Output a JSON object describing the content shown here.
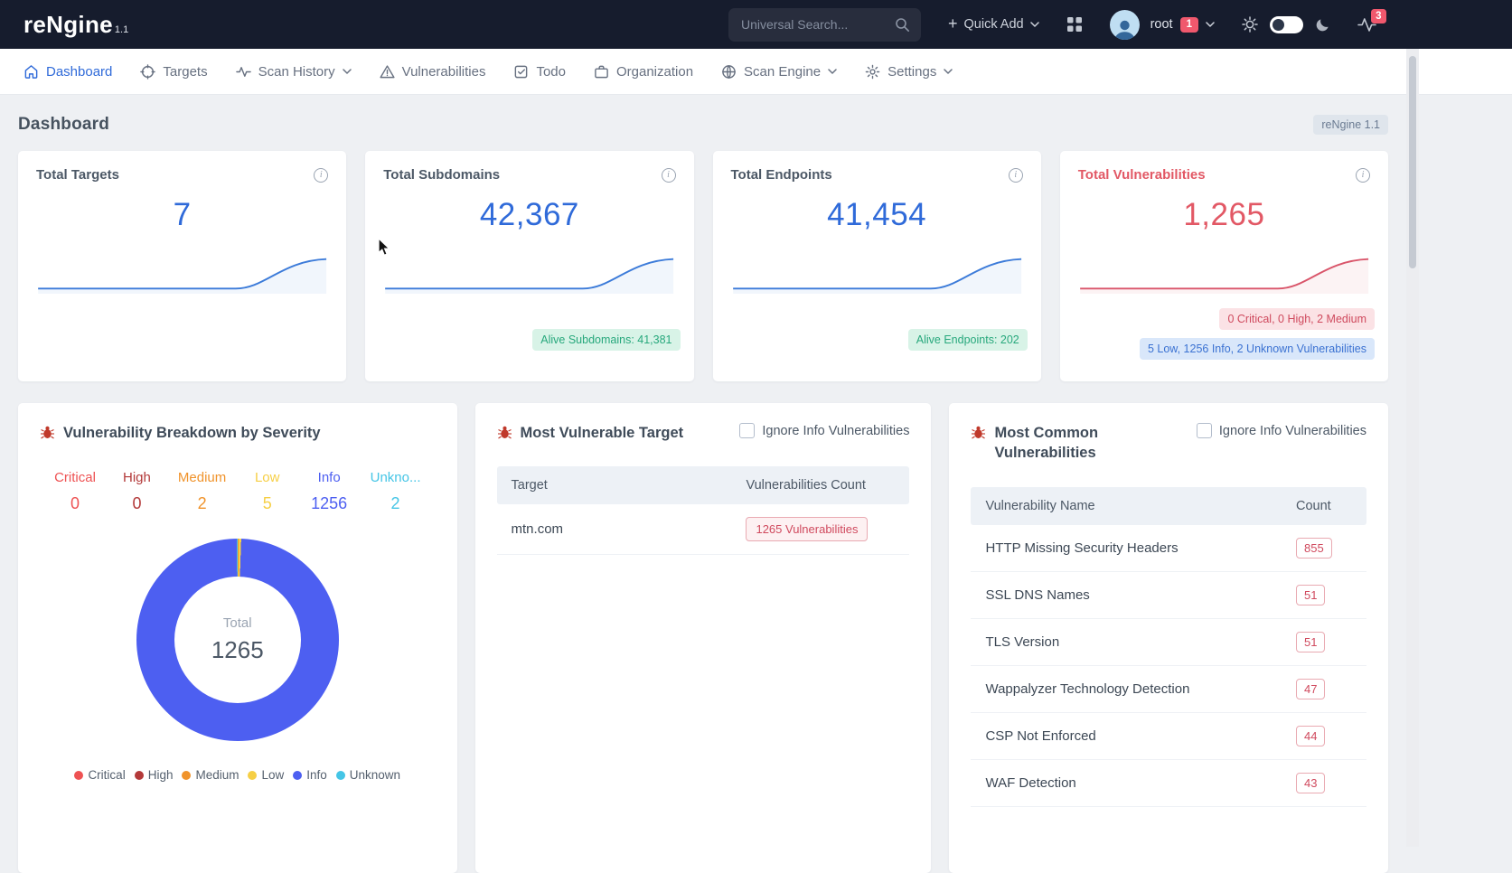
{
  "topbar": {
    "logo_text": "reNgine",
    "logo_version": "1.1",
    "search_placeholder": "Universal Search...",
    "quick_add_label": "Quick Add",
    "username": "root",
    "user_badge": "1",
    "notification_badge": "3"
  },
  "nav": {
    "items": [
      {
        "label": "Dashboard",
        "icon": "home-icon",
        "active": true
      },
      {
        "label": "Targets",
        "icon": "target-icon",
        "active": false
      },
      {
        "label": "Scan History",
        "icon": "wave-icon",
        "active": false,
        "has_dropdown": true
      },
      {
        "label": "Vulnerabilities",
        "icon": "alert-triangle-icon",
        "active": false
      },
      {
        "label": "Todo",
        "icon": "check-square-icon",
        "active": false
      },
      {
        "label": "Organization",
        "icon": "briefcase-icon",
        "active": false
      },
      {
        "label": "Scan Engine",
        "icon": "globe-icon",
        "active": false,
        "has_dropdown": true
      },
      {
        "label": "Settings",
        "icon": "gear-icon",
        "active": false,
        "has_dropdown": true
      }
    ]
  },
  "page": {
    "title": "Dashboard",
    "version_badge": "reNgine 1.1"
  },
  "stat_cards": [
    {
      "title": "Total Targets",
      "value": "7",
      "accent": "#2f6ad9"
    },
    {
      "title": "Total Subdomains",
      "value": "42,367",
      "accent": "#2f6ad9",
      "alive_badge": "Alive Subdomains: 41,381"
    },
    {
      "title": "Total Endpoints",
      "value": "41,454",
      "accent": "#2f6ad9",
      "alive_badge": "Alive Endpoints: 202"
    },
    {
      "title": "Total Vulnerabilities",
      "value": "1,265",
      "accent": "#e25865",
      "severity_badge": "0 Critical, 0 High, 2 Medium",
      "info_badge": "5 Low, 1256 Info, 2 Unknown Vulnerabilities"
    }
  ],
  "severity_card": {
    "title": "Vulnerability Breakdown by Severity",
    "total_label": "Total",
    "total_value": "1265",
    "items": [
      {
        "header_label": "Critical",
        "legend_label": "Critical",
        "value": 0,
        "color": "#ee5253"
      },
      {
        "header_label": "High",
        "legend_label": "High",
        "value": 0,
        "color": "#b33939"
      },
      {
        "header_label": "Medium",
        "legend_label": "Medium",
        "value": 2,
        "color": "#f0932b"
      },
      {
        "header_label": "Low",
        "legend_label": "Low",
        "value": 5,
        "color": "#f6cf45"
      },
      {
        "header_label": "Info",
        "legend_label": "Info",
        "value": 1256,
        "color": "#4d5ff1"
      },
      {
        "header_label": "Unkno...",
        "legend_label": "Unknown",
        "value": 2,
        "color": "#45c5e6"
      }
    ]
  },
  "most_vulnerable": {
    "title": "Most Vulnerable Target",
    "ignore_label": "Ignore Info Vulnerabilities",
    "columns": [
      "Target",
      "Vulnerabilities Count"
    ],
    "rows": [
      {
        "target": "mtn.com",
        "badge": "1265 Vulnerabilities"
      }
    ]
  },
  "common_vulns": {
    "title": "Most Common Vulnerabilities",
    "ignore_label": "Ignore Info Vulnerabilities",
    "columns": [
      "Vulnerability Name",
      "Count"
    ],
    "rows": [
      {
        "name": "HTTP Missing Security Headers",
        "count": "855"
      },
      {
        "name": "SSL DNS Names",
        "count": "51"
      },
      {
        "name": "TLS Version",
        "count": "51"
      },
      {
        "name": "Wappalyzer Technology Detection",
        "count": "47"
      },
      {
        "name": "CSP Not Enforced",
        "count": "44"
      },
      {
        "name": "WAF Detection",
        "count": "43"
      }
    ]
  },
  "chart_data": {
    "type": "pie",
    "title": "Vulnerability Breakdown by Severity",
    "categories": [
      "Critical",
      "High",
      "Medium",
      "Low",
      "Info",
      "Unknown"
    ],
    "values": [
      0,
      0,
      2,
      5,
      1256,
      2
    ],
    "total": 1265,
    "legend_position": "bottom"
  }
}
